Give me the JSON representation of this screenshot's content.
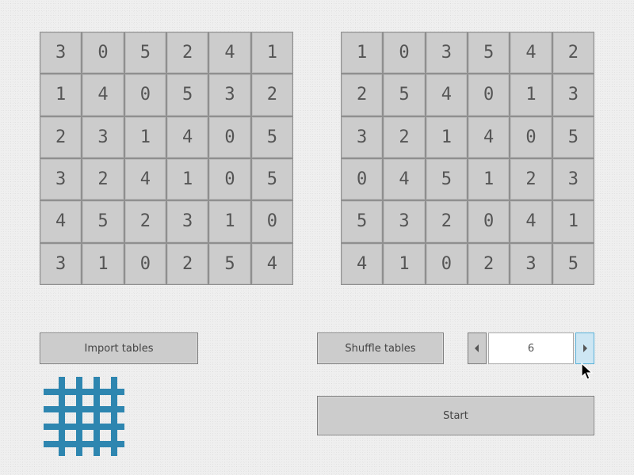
{
  "tables": {
    "left": [
      [
        "3",
        "0",
        "5",
        "2",
        "4",
        "1"
      ],
      [
        "1",
        "4",
        "0",
        "5",
        "3",
        "2"
      ],
      [
        "2",
        "3",
        "1",
        "4",
        "0",
        "5"
      ],
      [
        "3",
        "2",
        "4",
        "1",
        "0",
        "5"
      ],
      [
        "4",
        "5",
        "2",
        "3",
        "1",
        "0"
      ],
      [
        "3",
        "1",
        "0",
        "2",
        "5",
        "4"
      ]
    ],
    "right": [
      [
        "1",
        "0",
        "3",
        "5",
        "4",
        "2"
      ],
      [
        "2",
        "5",
        "4",
        "0",
        "1",
        "3"
      ],
      [
        "3",
        "2",
        "1",
        "4",
        "0",
        "5"
      ],
      [
        "0",
        "4",
        "5",
        "1",
        "2",
        "3"
      ],
      [
        "5",
        "3",
        "2",
        "0",
        "4",
        "1"
      ],
      [
        "4",
        "1",
        "0",
        "2",
        "3",
        "5"
      ]
    ]
  },
  "controls": {
    "import_label": "Import tables",
    "shuffle_label": "Shuffle tables",
    "start_label": "Start",
    "size_value": "6"
  },
  "icons": {
    "logo": "grid-icon",
    "decrement": "arrow-left-icon",
    "increment": "arrow-right-icon",
    "cursor": "mouse-pointer-icon"
  },
  "colors": {
    "background": "#efefef",
    "cell": "#cccccc",
    "cell_text": "#555555",
    "logo": "#2e86b0",
    "highlight": "#cde6f3",
    "highlight_border": "#5ab1d8"
  }
}
